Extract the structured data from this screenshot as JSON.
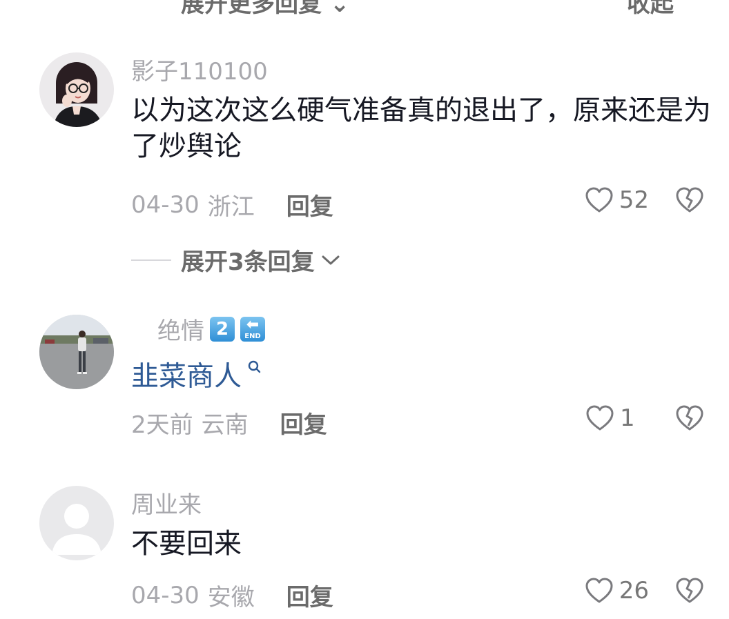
{
  "top_strip": {
    "expand_more_label": "展开更多回复 ⌄",
    "collapse_label": "收起"
  },
  "comments": [
    {
      "username": "影子110100",
      "text": "以为这次这么硬气准备真的退出了，原来还是为了炒舆论",
      "date": "04-30",
      "location": "浙江",
      "reply_label": "回复",
      "likes": "52",
      "avatar_icon": "cartoon-girl-avatar",
      "replies_label": "展开3条回复"
    },
    {
      "username": "绝情",
      "username_emoji_1": "2",
      "username_emoji_2_arrow": "⬅",
      "username_emoji_2_text": "END",
      "text": "韭菜商人",
      "text_is_search_link": true,
      "date": "2天前",
      "location": "云南",
      "reply_label": "回复",
      "likes": "1",
      "avatar_icon": "person-photo-avatar"
    },
    {
      "username": "周业来",
      "text": "不要回来",
      "date": "04-30",
      "location": "安徽",
      "reply_label": "回复",
      "likes": "26",
      "avatar_icon": "default-user-avatar"
    }
  ],
  "icons": {
    "like": "heart-outline-icon",
    "dislike": "broken-heart-icon",
    "chevron": "chevron-down-icon",
    "search": "search-icon"
  },
  "colors": {
    "username": "#a8a8ad",
    "text": "#161823",
    "link": "#2e5a95",
    "reply": "#6b6b6b"
  }
}
